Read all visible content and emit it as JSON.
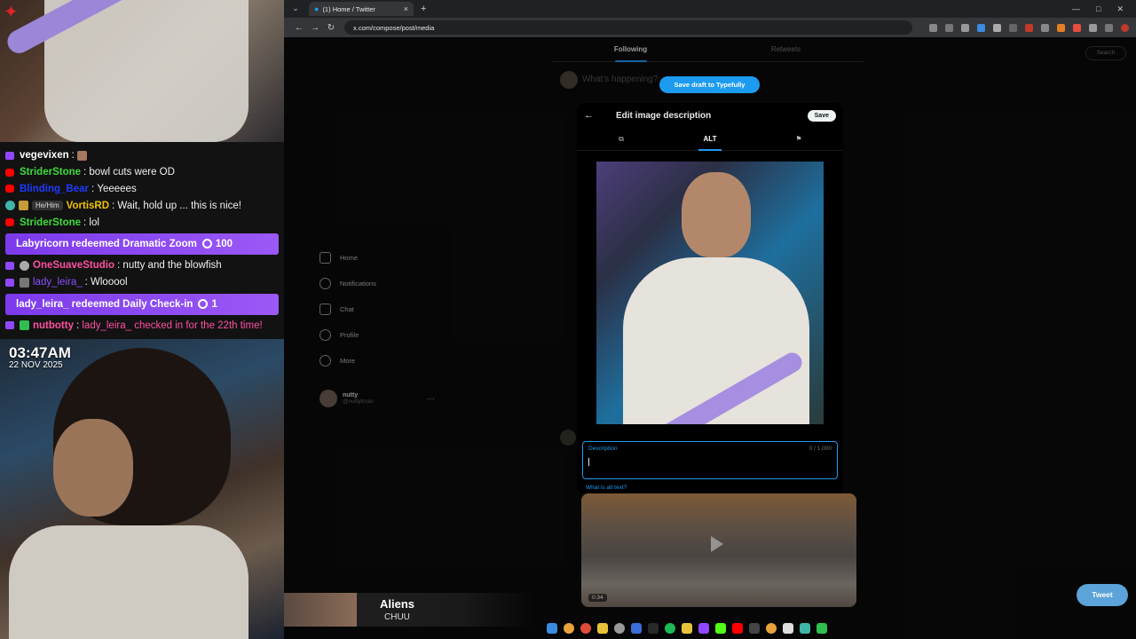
{
  "stream": {
    "time": "03:47AM",
    "date": "22 NOV 2025",
    "chat": [
      {
        "platform": "twitch",
        "user": "vegevixen",
        "user_color": "#ffffff",
        "message": "",
        "pronoun": ""
      },
      {
        "platform": "youtube",
        "user": "StriderStone",
        "user_color": "#3ddc3d",
        "message": "bowl cuts were OD",
        "pronoun": ""
      },
      {
        "platform": "youtube",
        "user": "Blinding_Bear",
        "user_color": "#1e3aff",
        "message": "Yeeeees",
        "pronoun": ""
      },
      {
        "platform": "twitch",
        "user": "VortisRD",
        "user_color": "#f0c000",
        "message": "Wait, hold up ... this is nice!",
        "pronoun": "He/Him"
      },
      {
        "platform": "youtube",
        "user": "StriderStone",
        "user_color": "#3ddc3d",
        "message": "lol",
        "pronoun": ""
      }
    ],
    "redeem1": {
      "text": "Labyricorn redeemed Dramatic Zoom",
      "cost": "100"
    },
    "chat2": [
      {
        "platform": "twitch",
        "user": "OneSuaveStudio",
        "user_color": "#ff4fa3",
        "message": "nutty and the blowfish"
      },
      {
        "platform": "twitch",
        "user": "lady_leira_",
        "user_color": "#8a4fff",
        "message": "Wlooool"
      }
    ],
    "redeem2": {
      "text": "lady_leira_ redeemed Daily Check-in",
      "cost": "1"
    },
    "bot": {
      "user": "nutbotty",
      "user_color": "#ff4fa3",
      "message": "lady_leira_ checked in for the 22th time!"
    }
  },
  "browser": {
    "tab_title": "(1) Home / Twitter",
    "url": "x.com/compose/post/media"
  },
  "twitter": {
    "feed_tabs": [
      "Following",
      "Retweets"
    ],
    "search_label": "Search",
    "compose_placeholder": "What's happening?",
    "typefully_label": "Save draft to Typefully",
    "nav": [
      "Home",
      "Notifications",
      "Chat",
      "Profile",
      "More"
    ],
    "profile": {
      "name": "nutty",
      "handle": "@nuttylmao"
    },
    "video_duration": "0:34",
    "tweet_button": "Tweet"
  },
  "modal": {
    "title": "Edit image description",
    "save_label": "Save",
    "tabs": [
      "",
      "ALT",
      ""
    ],
    "description_label": "Description",
    "char_count": "0 / 1,000",
    "alt_help_link": "What is alt text?"
  },
  "now_playing": {
    "title": "Aliens",
    "artist": "CHUU"
  },
  "colors": {
    "accent": "#1d9bf0",
    "redeem": "#8b47f0"
  }
}
